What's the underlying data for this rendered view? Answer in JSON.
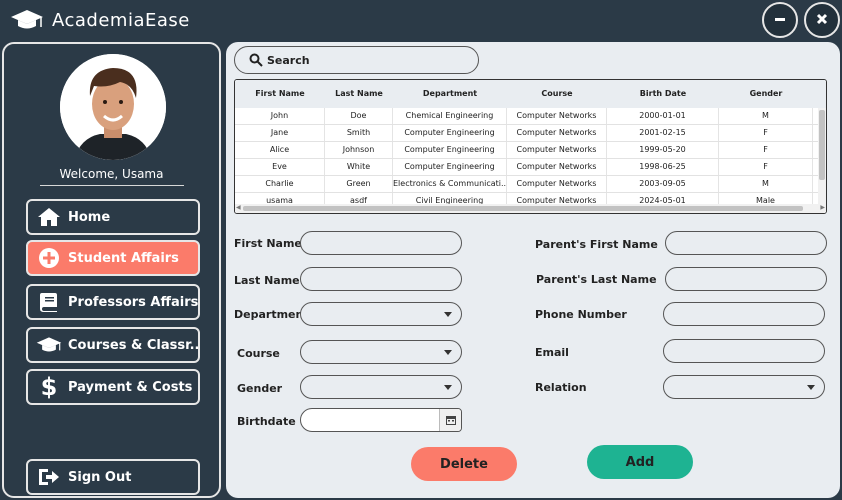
{
  "app": {
    "title": "AcademiaEase"
  },
  "window": {
    "minimize_icon": "minus-icon",
    "close_icon": "close-icon"
  },
  "sidebar": {
    "welcome": "Welcome, Usama",
    "nav": [
      {
        "label": "Home",
        "icon": "home-icon"
      },
      {
        "label": "Student Affairs",
        "icon": "plus-circle-icon",
        "active": true
      },
      {
        "label": "Professors Affairs",
        "icon": "book-icon"
      },
      {
        "label": "Courses & Classr...",
        "icon": "graduation-cap-icon"
      },
      {
        "label": "Payment & Costs",
        "icon": "dollar-icon"
      }
    ],
    "sign_out": "Sign Out"
  },
  "search": {
    "placeholder": "Search"
  },
  "table": {
    "columns": [
      "First Name",
      "Last Name",
      "Department",
      "Course",
      "Birth Date",
      "Gender"
    ],
    "rows": [
      [
        "John",
        "Doe",
        "Chemical Engineering",
        "Computer Networks",
        "2000-01-01",
        "M"
      ],
      [
        "Jane",
        "Smith",
        "Computer Engineering",
        "Computer Networks",
        "2001-02-15",
        "F"
      ],
      [
        "Alice",
        "Johnson",
        "Computer Engineering",
        "Computer Networks",
        "1999-05-20",
        "F"
      ],
      [
        "Eve",
        "White",
        "Computer Engineering",
        "Computer Networks",
        "1998-06-25",
        "F"
      ],
      [
        "Charlie",
        "Green",
        "Electronics & Communicati...",
        "Computer Networks",
        "2003-09-05",
        "M"
      ],
      [
        "usama",
        "asdf",
        "Civil Engineering",
        "Computer Networks",
        "2024-05-01",
        "Male"
      ]
    ]
  },
  "form": {
    "first_name": "First Name",
    "last_name": "Last Name",
    "department": "Department",
    "course": "Course",
    "gender": "Gender",
    "birthdate": "Birthdate",
    "parent_first_name": "Parent's First Name",
    "parent_last_name": "Parent's Last Name",
    "phone_number": "Phone Number",
    "email": "Email",
    "relation": "Relation"
  },
  "buttons": {
    "delete": "Delete",
    "add": "Add"
  },
  "colors": {
    "sidebar_bg": "#2b3a47",
    "panel_bg": "#e9edf1",
    "accent_coral": "#fb7b6a",
    "accent_teal": "#1eb392"
  }
}
